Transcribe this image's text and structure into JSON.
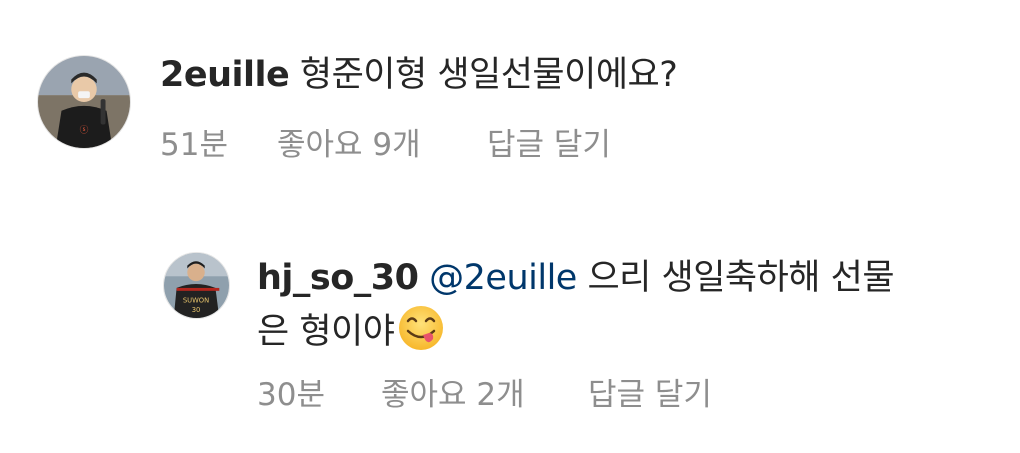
{
  "comments": [
    {
      "username": "2euille",
      "text": "형준이형 생일선물이에요?",
      "time": "51분",
      "likes": "좋아요 9개",
      "reply": "답글 달기",
      "avatar": "profile-photo-man-with-microphone"
    },
    {
      "username": "hj_so_30",
      "mention": "@2euille",
      "text_line1": "으리 생일축하해 선물",
      "text_line2": "은 형이야",
      "emoji": "yum-face-emoji",
      "time": "30분",
      "likes": "좋아요 2개",
      "reply": "답글 달기",
      "avatar": "profile-photo-baseball-player",
      "jersey_text": "SUWON",
      "jersey_number": "30"
    }
  ],
  "colors": {
    "text": "#262626",
    "secondary": "#8e8e8e",
    "mention": "#00376b",
    "background": "#ffffff"
  }
}
